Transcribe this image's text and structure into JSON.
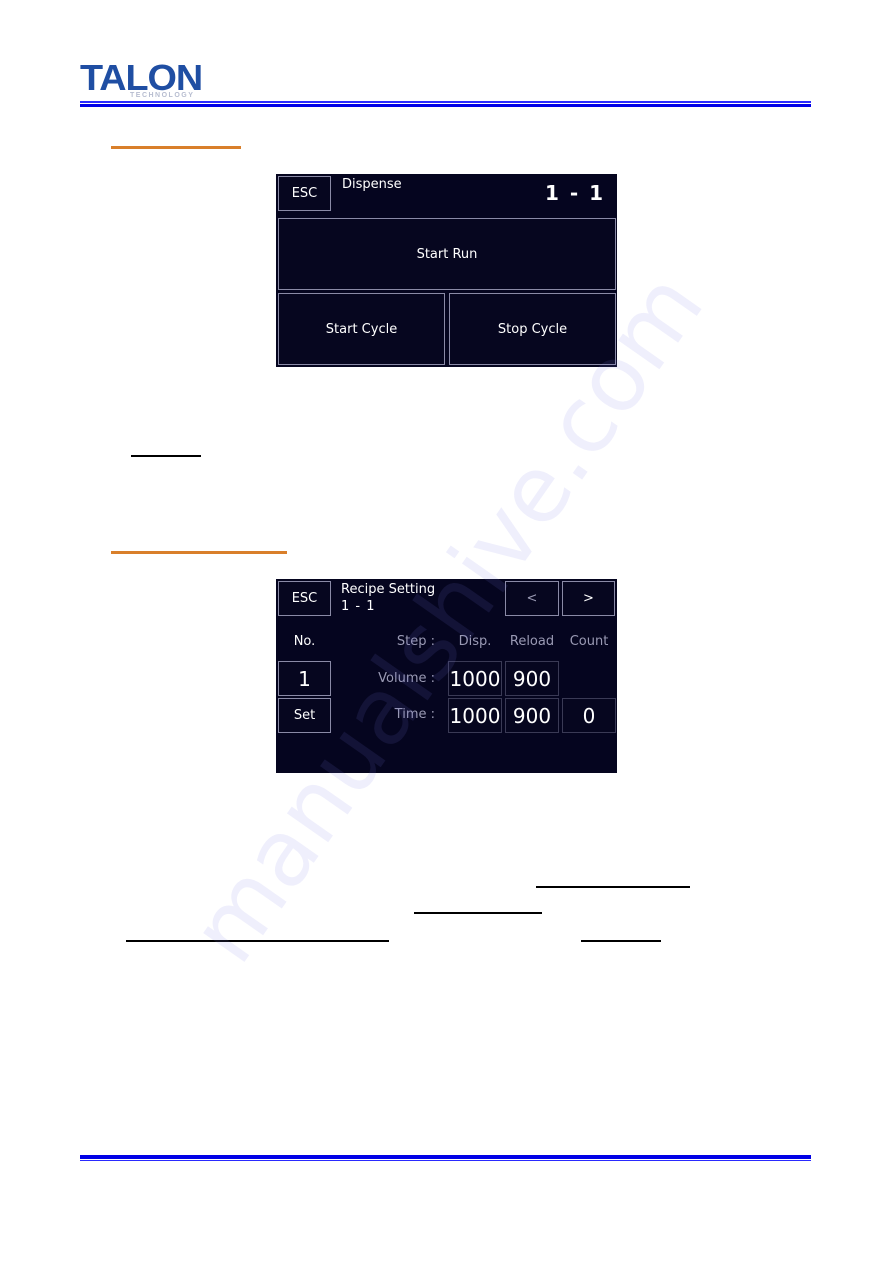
{
  "header": {
    "logo_text": "TALON",
    "logo_subtext": "TECHNOLOGY",
    "brand_color": "#1f4ea3",
    "rule_color": "#0000e6"
  },
  "watermark": "manualshive.com",
  "section_rule_color": "#d97f2a",
  "dispense_screen": {
    "esc_label": "ESC",
    "title": "Dispense",
    "indicator": "1 - 1",
    "start_run_label": "Start Run",
    "start_cycle_label": "Start Cycle",
    "stop_cycle_label": "Stop Cycle"
  },
  "recipe_screen": {
    "esc_label": "ESC",
    "title": "Recipe Setting",
    "subtitle": "1 - 1",
    "prev_label": "<",
    "next_label": ">",
    "no_label": "No.",
    "no_value": "1",
    "set_label": "Set",
    "step_label": "Step :",
    "columns": [
      "Disp.",
      "Reload",
      "Count"
    ],
    "rows": [
      {
        "label": "Volume :",
        "disp": "1000",
        "reload": "900"
      },
      {
        "label": "Time :",
        "disp": "1000",
        "reload": "900",
        "count": "0"
      }
    ]
  }
}
